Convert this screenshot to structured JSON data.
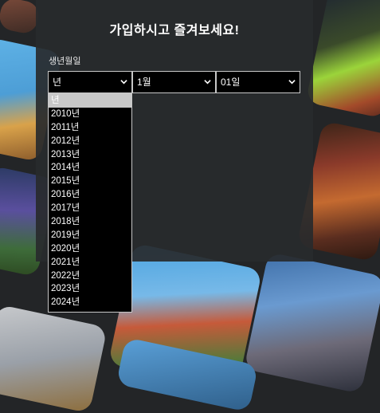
{
  "panel": {
    "title": "가입하시고 즐겨보세요!",
    "dob_label": "생년월일"
  },
  "birthday": {
    "year_select": {
      "value": "년",
      "icon": "chevron-down-icon"
    },
    "month_select": {
      "value": "1월",
      "icon": "chevron-down-icon"
    },
    "day_select": {
      "value": "01일",
      "icon": "chevron-down-icon"
    },
    "year_options": [
      "년",
      "2010년",
      "2011년",
      "2012년",
      "2013년",
      "2014년",
      "2015년",
      "2016년",
      "2017년",
      "2018년",
      "2019년",
      "2020년",
      "2021년",
      "2022년",
      "2023년",
      "2024년"
    ],
    "highlighted_option": "년"
  },
  "colors": {
    "page_background": "#232527",
    "panel_background": "#2a2c2e",
    "select_background": "#000000",
    "select_border": "#c8c8c8",
    "highlight": "#c8c8c8",
    "text": "#ffffff"
  }
}
